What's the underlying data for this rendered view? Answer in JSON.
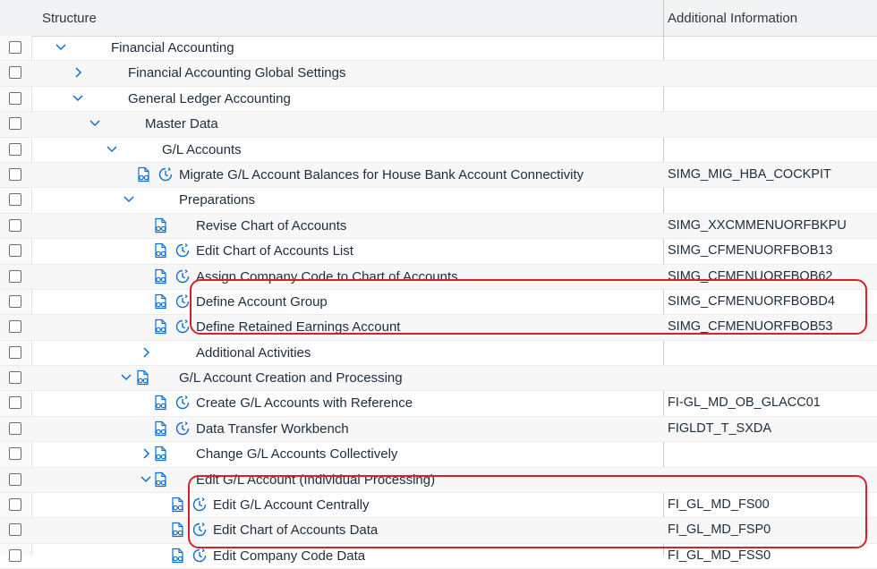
{
  "header": {
    "structure_label": "Structure",
    "additional_info_label": "Additional Information"
  },
  "colors": {
    "accent": "#0a6ed1",
    "highlight": "#d9202c"
  },
  "rows": [
    {
      "label": "Financial Accounting",
      "info": "",
      "twisty": "expanded"
    },
    {
      "label": "Financial Accounting Global Settings",
      "info": "",
      "twisty": "collapsed"
    },
    {
      "label": "General Ledger Accounting",
      "info": "",
      "twisty": "expanded"
    },
    {
      "label": "Master Data",
      "info": "",
      "twisty": "expanded"
    },
    {
      "label": "G/L Accounts",
      "info": "",
      "twisty": "expanded"
    },
    {
      "label": "Migrate G/L Account Balances for House Bank Account Connectivity",
      "info": "SIMG_MIG_HBA_COCKPIT",
      "icons": [
        "document-glasses-icon",
        "clock-execute-icon"
      ]
    },
    {
      "label": "Preparations",
      "info": "",
      "twisty": "expanded"
    },
    {
      "label": "Revise Chart of Accounts",
      "info": "SIMG_XXCMMENUORFBKPU",
      "icons": [
        "document-glasses-icon"
      ]
    },
    {
      "label": "Edit Chart of Accounts List",
      "info": "SIMG_CFMENUORFBOB13",
      "icons": [
        "document-glasses-icon",
        "clock-execute-icon"
      ]
    },
    {
      "label": "Assign Company Code to Chart of Accounts",
      "info": "SIMG_CFMENUORFBOB62",
      "icons": [
        "document-glasses-icon",
        "clock-execute-icon"
      ]
    },
    {
      "label": "Define Account Group",
      "info": "SIMG_CFMENUORFBOBD4",
      "icons": [
        "document-glasses-icon",
        "clock-execute-icon"
      ]
    },
    {
      "label": "Define Retained Earnings Account",
      "info": "SIMG_CFMENUORFBOB53",
      "icons": [
        "document-glasses-icon",
        "clock-execute-icon"
      ]
    },
    {
      "label": "Additional Activities",
      "info": "",
      "twisty": "collapsed"
    },
    {
      "label": "G/L Account Creation and Processing",
      "info": "",
      "twisty": "expanded",
      "icons": [
        "document-glasses-icon"
      ]
    },
    {
      "label": "Create G/L Accounts with Reference",
      "info": "FI-GL_MD_OB_GLACC01",
      "icons": [
        "document-glasses-icon",
        "clock-execute-icon"
      ]
    },
    {
      "label": "Data Transfer Workbench",
      "info": "FIGLDT_T_SXDA",
      "icons": [
        "document-glasses-icon",
        "clock-execute-icon"
      ]
    },
    {
      "label": "Change G/L Accounts Collectively",
      "info": "",
      "twisty": "collapsed",
      "icons": [
        "document-glasses-icon"
      ]
    },
    {
      "label": "Edit G/L Account (Individual Processing)",
      "info": "",
      "twisty": "expanded",
      "icons": [
        "document-glasses-icon"
      ]
    },
    {
      "label": "Edit G/L Account Centrally",
      "info": "FI_GL_MD_FS00",
      "icons": [
        "document-glasses-icon",
        "clock-execute-icon"
      ]
    },
    {
      "label": "Edit Chart of Accounts Data",
      "info": "FI_GL_MD_FSP0",
      "icons": [
        "document-glasses-icon",
        "clock-execute-icon"
      ]
    },
    {
      "label": "Edit Company Code Data",
      "info": "FI_GL_MD_FSS0",
      "icons": [
        "document-glasses-icon",
        "clock-execute-icon"
      ]
    }
  ]
}
